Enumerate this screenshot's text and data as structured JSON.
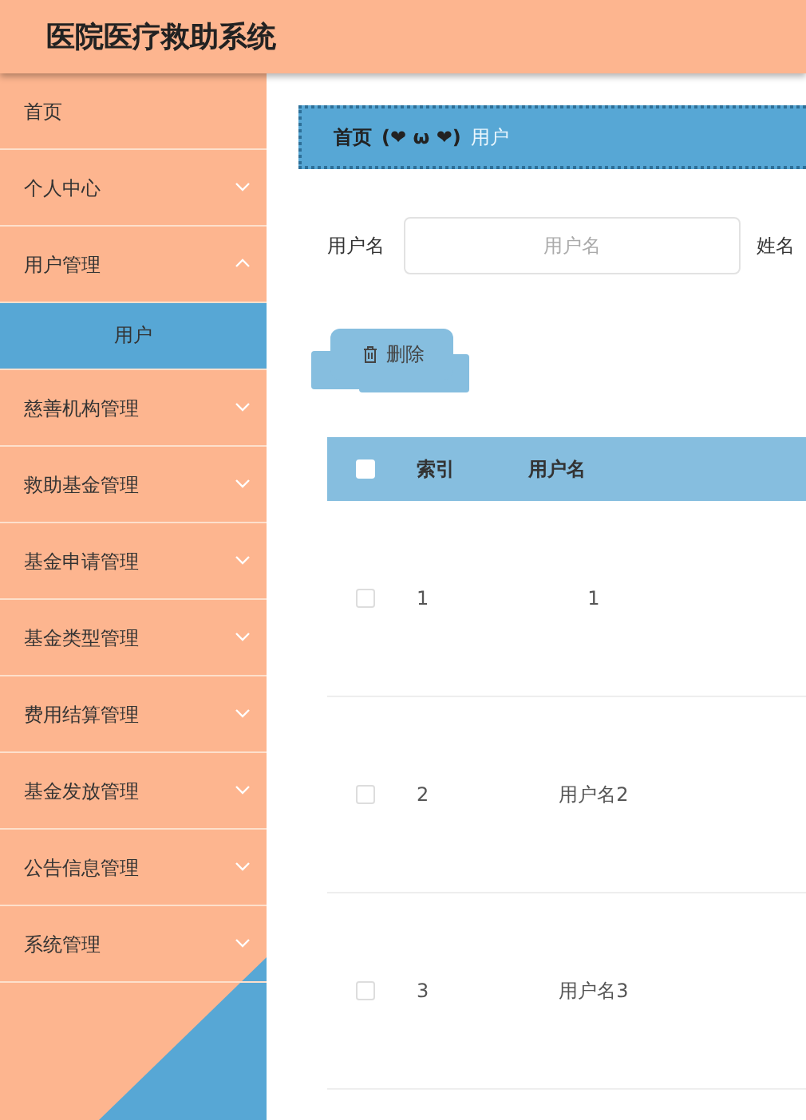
{
  "header": {
    "title": "医院医疗救助系统"
  },
  "sidebar": {
    "items": [
      {
        "label": "首页",
        "kind": "link"
      },
      {
        "label": "个人中心",
        "kind": "submenu",
        "expanded": false
      },
      {
        "label": "用户管理",
        "kind": "submenu",
        "expanded": true,
        "children": [
          {
            "label": "用户",
            "selected": true
          }
        ]
      },
      {
        "label": "慈善机构管理",
        "kind": "submenu",
        "expanded": false
      },
      {
        "label": "救助基金管理",
        "kind": "submenu",
        "expanded": false
      },
      {
        "label": "基金申请管理",
        "kind": "submenu",
        "expanded": false
      },
      {
        "label": "基金类型管理",
        "kind": "submenu",
        "expanded": false
      },
      {
        "label": "费用结算管理",
        "kind": "submenu",
        "expanded": false
      },
      {
        "label": "基金发放管理",
        "kind": "submenu",
        "expanded": false
      },
      {
        "label": "公告信息管理",
        "kind": "submenu",
        "expanded": false
      },
      {
        "label": "系统管理",
        "kind": "submenu",
        "expanded": false
      }
    ]
  },
  "breadcrumb": {
    "items": [
      "首页",
      "用户"
    ],
    "separator": "(❤ ω ❤)"
  },
  "search": {
    "fields": [
      {
        "label": "用户名",
        "placeholder": "用户名"
      }
    ],
    "next_label": "姓名"
  },
  "toolbar": {
    "buttons": [
      "删除"
    ]
  },
  "table": {
    "select_all_checked": false,
    "columns": [
      "索引",
      "用户名"
    ],
    "rows": [
      {
        "checked": false,
        "cells": [
          "1",
          "1"
        ]
      },
      {
        "checked": false,
        "cells": [
          "2",
          "用户名2"
        ]
      },
      {
        "checked": false,
        "cells": [
          "3",
          "用户名3"
        ]
      }
    ]
  }
}
